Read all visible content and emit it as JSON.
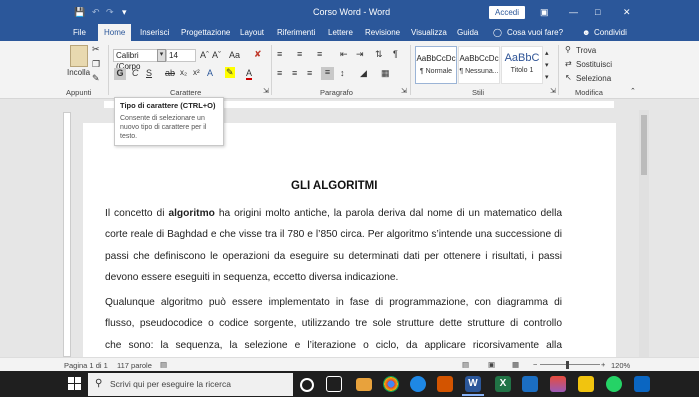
{
  "titlebar": {
    "document_title": "Corso Word  -  Word",
    "signin_label": "Accedi",
    "save_icon": "save-icon",
    "undo_icon": "undo-icon",
    "redo_icon": "redo-icon",
    "customize_icon": "customize-qat-icon"
  },
  "tabs": [
    "File",
    "Home",
    "Inserisci",
    "Progettazione",
    "Layout",
    "Riferimenti",
    "Lettere",
    "Revisione",
    "Visualizza",
    "Guida"
  ],
  "tell_me": "Cosa vuoi fare?",
  "share_label": "Condividi",
  "ribbon": {
    "clipboard": {
      "paste_label": "Incolla",
      "group_label": "Appunti"
    },
    "font": {
      "font_name": "Calibri (Corpo",
      "font_size": "14",
      "group_label": "Carattere",
      "bold": "G",
      "italic": "C",
      "underline": "S",
      "aa": "Aa"
    },
    "paragraph": {
      "group_label": "Paragrafo"
    },
    "styles": {
      "group_label": "Stili",
      "items": [
        {
          "preview": "AaBbCcDc",
          "name": "¶ Normale"
        },
        {
          "preview": "AaBbCcDc",
          "name": "¶ Nessuna..."
        },
        {
          "preview": "AaBbC",
          "name": "Titolo 1"
        }
      ]
    },
    "editing": {
      "group_label": "Modifica",
      "find": "Trova",
      "replace": "Sostituisci",
      "select": "Seleziona"
    }
  },
  "tooltip": {
    "title": "Tipo di carattere (CTRL+O)",
    "description": "Consente di selezionare un nuovo tipo di carattere per il testo."
  },
  "document": {
    "title": "GLI ALGORITMI",
    "paragraph1_lines": [
      [
        "Il concetto di ",
        "algoritmo",
        " ha origini molto antiche, la parola deriva dal nome di un matematico della"
      ],
      [
        "corte reale di Baghdad e che visse tra il 780 e l’850 circa. Per algoritmo s’intende una successione di"
      ],
      [
        "passi che definiscono le operazioni da eseguire su determinati dati per ottenere i risultati, i passi"
      ],
      [
        "devono essere eseguiti in sequenza, eccetto diversa indicazione."
      ]
    ],
    "paragraph2_lines": [
      "Qualunque algoritmo può essere implementato in fase di programmazione, con diagramma di",
      "flusso, pseudocodice o codice sorgente, utilizzando tre sole strutture dette strutture di controllo",
      "che sono: la sequenza, la selezione e l’iterazione o ciclo, da applicare ricorsivamente alla"
    ]
  },
  "statusbar": {
    "page": "Pagina 1 di 1",
    "words": "117 parole",
    "zoom": "120%"
  },
  "taskbar": {
    "search_placeholder": "Scrivi qui per eseguire la ricerca"
  }
}
